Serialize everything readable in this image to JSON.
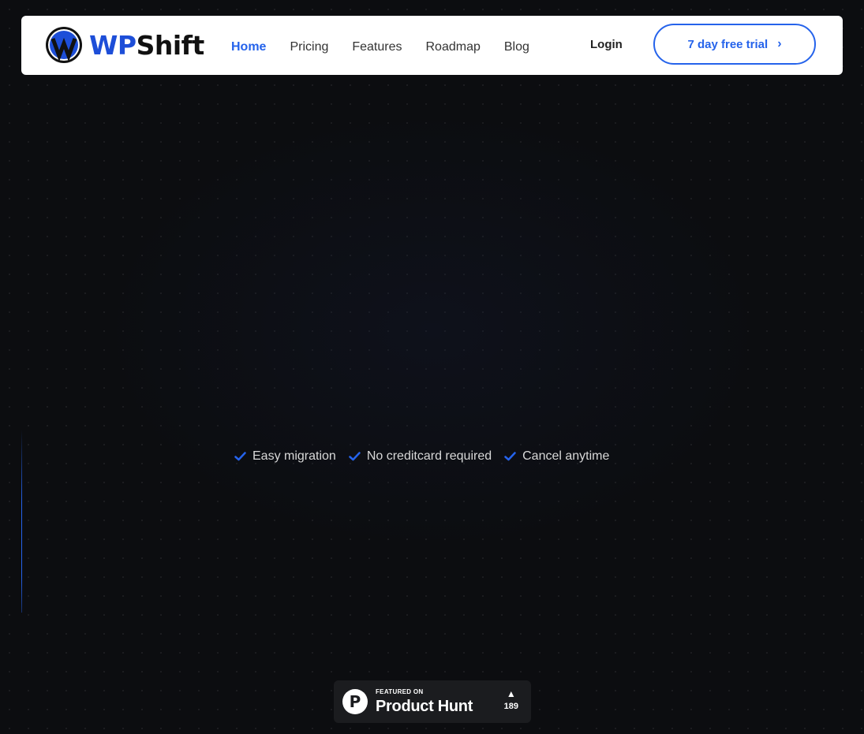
{
  "brand": {
    "name_part1": "WP",
    "name_part2": "Shift",
    "primary_color": "#2563eb"
  },
  "nav": {
    "items": [
      {
        "label": "Home",
        "active": true
      },
      {
        "label": "Pricing",
        "active": false
      },
      {
        "label": "Features",
        "active": false
      },
      {
        "label": "Roadmap",
        "active": false
      },
      {
        "label": "Blog",
        "active": false
      }
    ],
    "login_label": "Login",
    "cta_label": "7 day free trial",
    "cta_icon": "chevron-right-icon"
  },
  "features": [
    {
      "label": "Easy migration",
      "icon": "check-icon"
    },
    {
      "label": "No creditcard required",
      "icon": "check-icon"
    },
    {
      "label": "Cancel anytime",
      "icon": "check-icon"
    }
  ],
  "product_hunt": {
    "featured_on": "FEATURED ON",
    "name": "Product Hunt",
    "upvote_icon": "upvote-triangle-icon",
    "votes": "189"
  }
}
